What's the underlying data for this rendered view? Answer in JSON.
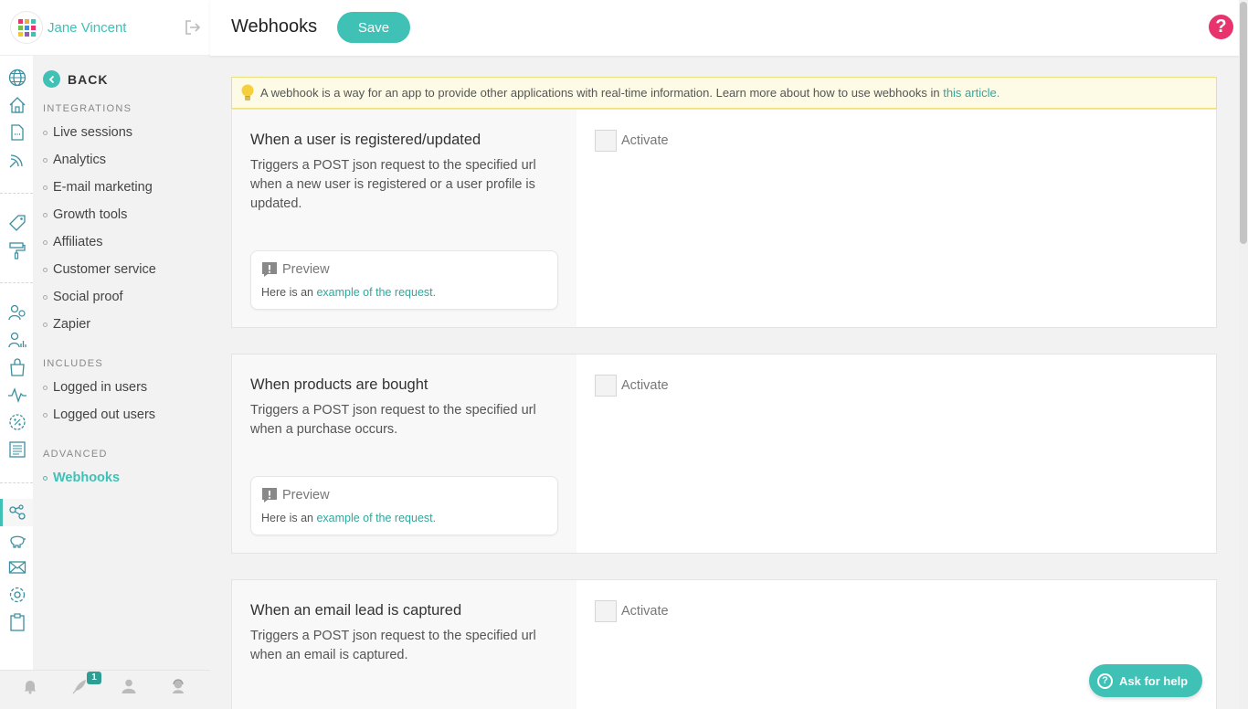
{
  "user": {
    "name": "Jane Vincent",
    "avatar_colors": [
      "#e8336d",
      "#f2a93b",
      "#3fc1b5",
      "#6fbf4a",
      "#3a8ee6",
      "#e8336d",
      "#f2c43b",
      "#9b59b6",
      "#3fc1b5"
    ]
  },
  "subnav": {
    "back_label": "BACK",
    "sections": [
      {
        "title": "INTEGRATIONS",
        "items": [
          "Live sessions",
          "Analytics",
          "E-mail marketing",
          "Growth tools",
          "Affiliates",
          "Customer service",
          "Social proof",
          "Zapier"
        ]
      },
      {
        "title": "INCLUDES",
        "items": [
          "Logged in users",
          "Logged out users"
        ]
      },
      {
        "title": "ADVANCED",
        "items": [
          "Webhooks"
        ]
      }
    ],
    "active_item": "Webhooks"
  },
  "bottom_bar": {
    "notification_count": "1"
  },
  "header": {
    "title": "Webhooks",
    "save_label": "Save",
    "help_glyph": "?"
  },
  "banner": {
    "text": "A webhook is a way for an app to provide other applications with real-time information. Learn more about how to use webhooks in ",
    "link_text": "this article",
    "suffix": "."
  },
  "webhooks": [
    {
      "title": "When a user is registered/updated",
      "description": "Triggers a POST json request to the specified url when a new user is registered or a user profile is updated.",
      "preview_label": "Preview",
      "preview_prefix": "Here is an ",
      "preview_link": "example of the request",
      "preview_suffix": ".",
      "activate_label": "Activate"
    },
    {
      "title": "When products are bought",
      "description": "Triggers a POST json request to the specified url when a purchase occurs.",
      "preview_label": "Preview",
      "preview_prefix": "Here is an ",
      "preview_link": "example of the request",
      "preview_suffix": ".",
      "activate_label": "Activate"
    },
    {
      "title": "When an email lead is captured",
      "description": "Triggers a POST json request to the specified url when an email is captured.",
      "activate_label": "Activate"
    }
  ],
  "ask_help": {
    "glyph": "?",
    "label": "Ask for help"
  },
  "colors": {
    "accent": "#3fc1b5",
    "help": "#e8336d",
    "banner_bg": "#fdfbe6"
  }
}
